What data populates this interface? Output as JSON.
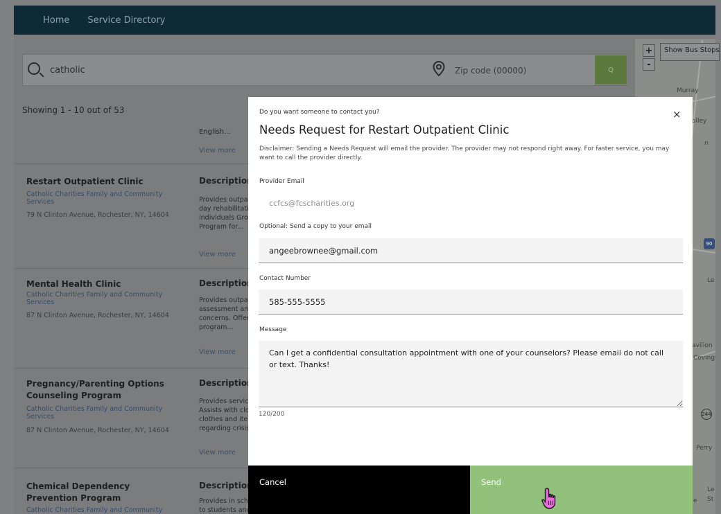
{
  "nav": {
    "items": [
      "Home",
      "Service Directory"
    ]
  },
  "search": {
    "query": "catholic",
    "zip_placeholder": "Zip code (00000)",
    "button_label": "Q"
  },
  "results": {
    "showing": "Showing 1 - 10 out of 53",
    "prev_language": "English...",
    "prev_view_more": "View more",
    "cards": [
      {
        "title": "Restart Outpatient Clinic",
        "org": "Catholic Charities Family and Community Services",
        "address": "79 N Clinton Avenue, Rochester, NY, 14604",
        "desc_heading": "Description",
        "desc_lines": [
          "Provides outpatient",
          "day rehabilitation",
          "individuals Group",
          "Program for..."
        ],
        "view_more": "View more"
      },
      {
        "title": "Mental Health Clinic",
        "org": "Catholic Charities Family and Community Services",
        "address": "87 N Clinton Avenue, Rochester, NY, 14604",
        "desc_heading": "Description",
        "desc_lines": [
          "Provides outpatient",
          "assessment and",
          "concerns. Offers",
          "program..."
        ],
        "view_more": "View more"
      },
      {
        "title": "Pregnancy/Parenting Options Counseling Program",
        "org": "Catholic Charities Family and Community Services",
        "address": "87 N Clinton Avenue, Rochester, NY, 14604",
        "desc_heading": "Description",
        "desc_lines": [
          "Provides services",
          "Assists with clothes",
          "clothes and items",
          "regarding crisis"
        ],
        "view_more": "View more"
      },
      {
        "title": "Chemical Dependency Prevention Program",
        "org": "Catholic Charities Family and Community",
        "address": "",
        "desc_heading": "Description",
        "desc_lines": [
          "Provides in schools",
          "to students and families. Focus on anger issues, mental health"
        ],
        "view_more": ""
      }
    ]
  },
  "map": {
    "zoom_in": "+",
    "zoom_out": "-",
    "bus_stops": "Show Bus Stops",
    "labels": [
      "Murray",
      "olley",
      "n",
      "Le",
      "avilion",
      "Covingto",
      "Perry",
      "Le",
      "St",
      "e"
    ],
    "shields": [
      "90",
      "244"
    ]
  },
  "modal": {
    "prompt": "Do you want someone to contact you?",
    "close": "×",
    "title": "Needs Request for Restart Outpatient Clinic",
    "disclaimer": "Disclaimer: Sending a Needs Request will email the provider. The provider may not respond right away. For faster service, you may want to call the provider directly.",
    "provider_email_label": "Provider Email",
    "provider_email": "ccfcs@fcscharities.org",
    "copy_label": "Optional: Send a copy to your email",
    "copy_email": "angeebrownee@gmail.com",
    "contact_label": "Contact Number",
    "contact_number": "585-555-5555",
    "message_label": "Message",
    "message": "Can I get a confidential consultation appointment with one of your counselors? Please email do not call or text. Thanks!",
    "char_count": "120/200",
    "cancel": "Cancel",
    "send": "Send"
  },
  "colors": {
    "nav": "#0f2a37",
    "send": "#91c17b",
    "cancel": "#000000",
    "search_button": "#5d7a3e"
  }
}
